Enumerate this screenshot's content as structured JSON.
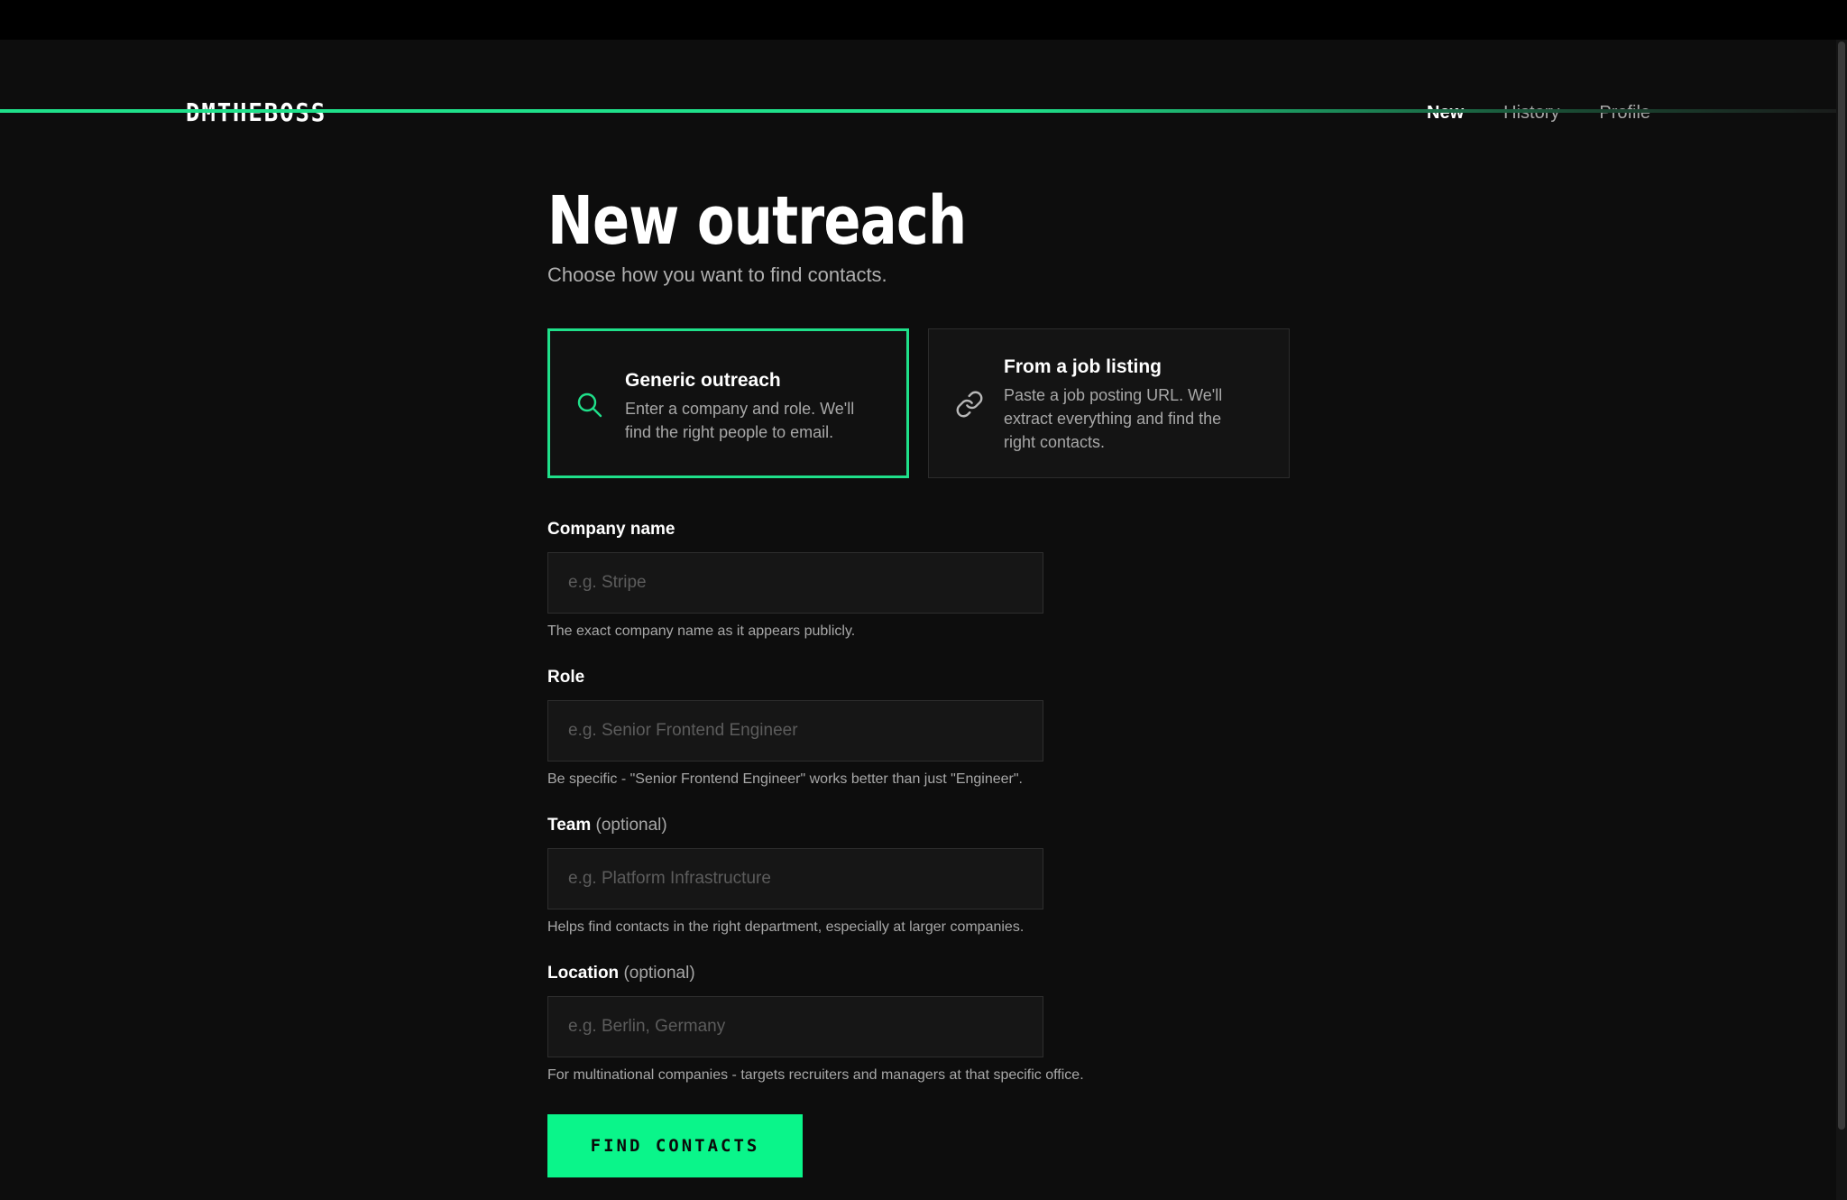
{
  "app": {
    "logo": "DMTHEBOSS"
  },
  "nav": [
    {
      "label": "New",
      "active": true
    },
    {
      "label": "History",
      "active": false
    },
    {
      "label": "Profile",
      "active": false
    }
  ],
  "page": {
    "title": "New outreach",
    "subtitle": "Choose how you want to find contacts."
  },
  "modes": {
    "generic": {
      "title": "Generic outreach",
      "description": "Enter a company and role. We'll find the right people to email.",
      "icon": "search-icon",
      "selected": true
    },
    "listing": {
      "title": "From a job listing",
      "description": "Paste a job posting URL. We'll extract everything and find the right contacts.",
      "icon": "link-icon",
      "selected": false
    }
  },
  "form": {
    "company": {
      "label": "Company name",
      "placeholder": "e.g. Stripe",
      "value": "",
      "help": "The exact company name as it appears publicly."
    },
    "role": {
      "label": "Role",
      "placeholder": "e.g. Senior Frontend Engineer",
      "value": "",
      "help": "Be specific - \"Senior Frontend Engineer\" works better than just \"Engineer\"."
    },
    "team": {
      "label": "Team",
      "optional": "(optional)",
      "placeholder": "e.g. Platform Infrastructure",
      "value": "",
      "help": "Helps find contacts in the right department, especially at larger companies."
    },
    "location": {
      "label": "Location",
      "optional": "(optional)",
      "placeholder": "e.g. Berlin, Germany",
      "value": "",
      "help": "For multinational companies - targets recruiters and managers at that specific office."
    },
    "submit_label": "FIND CONTACTS"
  },
  "colors": {
    "accent": "#1fe08a",
    "button": "#0af58a",
    "background": "#0d0d0d"
  }
}
